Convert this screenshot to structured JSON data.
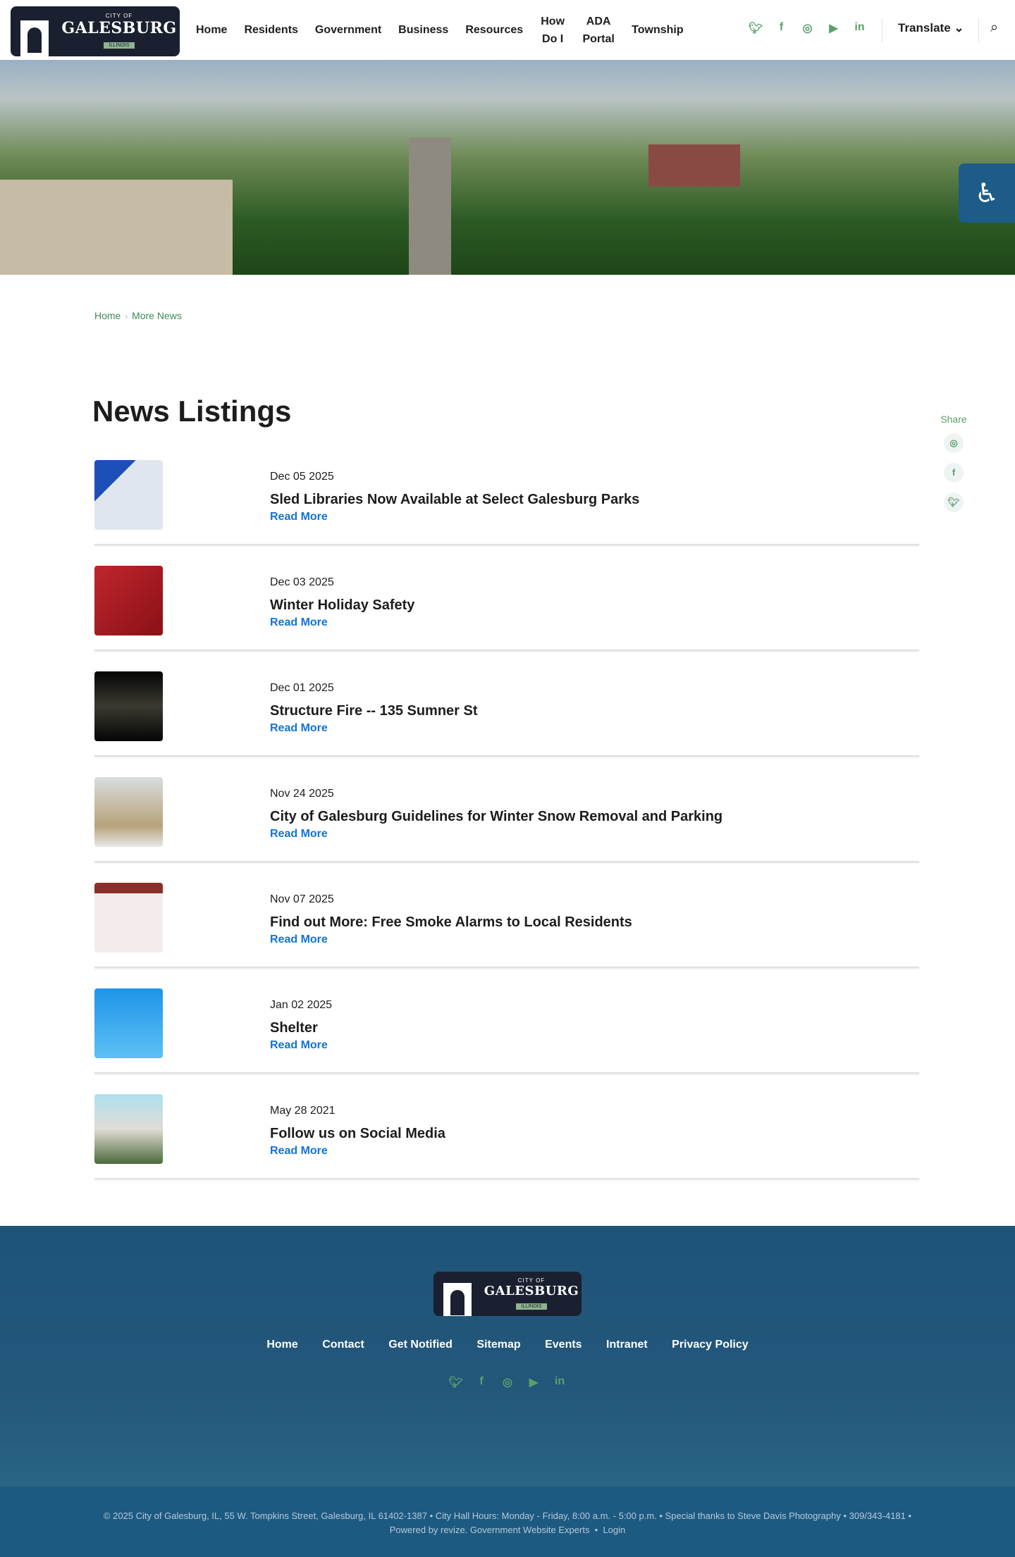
{
  "header": {
    "logo": {
      "city_of": "CITY OF",
      "name": "GALESBURG",
      "state": "ILLINOIS"
    },
    "nav": [
      "Home",
      "Residents",
      "Government",
      "Business",
      "Resources",
      "How Do I",
      "ADA Portal",
      "Township"
    ],
    "translate": "Translate ⌄"
  },
  "breadcrumb": {
    "home": "Home",
    "current": "More News"
  },
  "page_title": "News Listings",
  "share": {
    "label": "Share"
  },
  "items": [
    {
      "date": "Dec 05 2025",
      "title": "Sled Libraries Now Available at Select Galesburg Parks",
      "more": "Read More"
    },
    {
      "date": "Dec 03 2025",
      "title": "Winter Holiday Safety",
      "more": "Read More"
    },
    {
      "date": "Dec 01 2025",
      "title": "Structure Fire -- 135 Sumner St",
      "more": "Read More"
    },
    {
      "date": "Nov 24 2025",
      "title": "City of Galesburg Guidelines for Winter Snow Removal and Parking",
      "more": "Read More"
    },
    {
      "date": "Nov 07 2025",
      "title": "Find out More:  Free Smoke Alarms to Local Residents",
      "more": "Read More"
    },
    {
      "date": "Jan 02 2025",
      "title": "Shelter",
      "more": "Read More"
    },
    {
      "date": "May 28 2021",
      "title": "Follow us on Social Media",
      "more": "Read More"
    }
  ],
  "footer": {
    "links": [
      "Home",
      "Contact",
      "Get Notified",
      "Sitemap",
      "Events",
      "Intranet",
      "Privacy Policy"
    ],
    "line1": "© 2025 City of Galesburg, IL, 55 W. Tompkins Street, Galesburg, IL 61402-1387  •  City Hall Hours: Monday - Friday, 8:00 a.m. - 5:00 p.m.  •  Special thanks to Steve Davis Photography  •  309/343-4181  •",
    "powered": "Powered by revize. Government Website Experts",
    "login": "Login"
  },
  "colors": {
    "accent": "#5aa06a",
    "link": "#1273d6",
    "footer": "#1d5a82"
  }
}
